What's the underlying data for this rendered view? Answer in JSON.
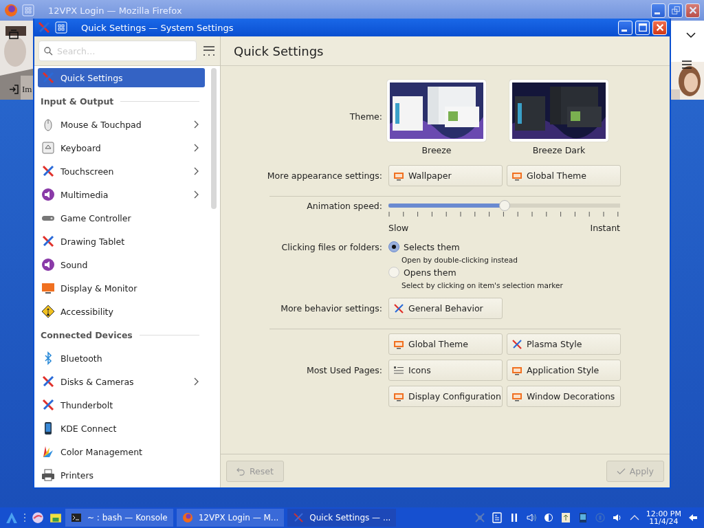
{
  "firefox_window": {
    "title": "12VPX Login — Mozilla Firefox",
    "page_text": "Im"
  },
  "settings_window": {
    "title": "Quick Settings — System Settings"
  },
  "sidebar": {
    "search": {
      "placeholder": "Search…"
    },
    "items": [
      {
        "kind": "item",
        "label": "Quick Settings",
        "selected": true,
        "has_arrow": false
      },
      {
        "kind": "section",
        "label": "Input & Output"
      },
      {
        "kind": "item",
        "label": "Mouse & Touchpad",
        "selected": false,
        "has_arrow": true
      },
      {
        "kind": "item",
        "label": "Keyboard",
        "selected": false,
        "has_arrow": true
      },
      {
        "kind": "item",
        "label": "Touchscreen",
        "selected": false,
        "has_arrow": true
      },
      {
        "kind": "item",
        "label": "Multimedia",
        "selected": false,
        "has_arrow": true
      },
      {
        "kind": "item",
        "label": "Game Controller",
        "selected": false,
        "has_arrow": false
      },
      {
        "kind": "item",
        "label": "Drawing Tablet",
        "selected": false,
        "has_arrow": false
      },
      {
        "kind": "item",
        "label": "Sound",
        "selected": false,
        "has_arrow": false
      },
      {
        "kind": "item",
        "label": "Display & Monitor",
        "selected": false,
        "has_arrow": false
      },
      {
        "kind": "item",
        "label": "Accessibility",
        "selected": false,
        "has_arrow": false
      },
      {
        "kind": "section",
        "label": "Connected Devices"
      },
      {
        "kind": "item",
        "label": "Bluetooth",
        "selected": false,
        "has_arrow": false
      },
      {
        "kind": "item",
        "label": "Disks & Cameras",
        "selected": false,
        "has_arrow": true
      },
      {
        "kind": "item",
        "label": "Thunderbolt",
        "selected": false,
        "has_arrow": false
      },
      {
        "kind": "item",
        "label": "KDE Connect",
        "selected": false,
        "has_arrow": false
      },
      {
        "kind": "item",
        "label": "Color Management",
        "selected": false,
        "has_arrow": false
      },
      {
        "kind": "item",
        "label": "Printers",
        "selected": false,
        "has_arrow": false
      }
    ]
  },
  "page": {
    "title": "Quick Settings",
    "theme": {
      "label": "Theme:",
      "options": [
        {
          "name": "Breeze"
        },
        {
          "name": "Breeze Dark"
        }
      ]
    },
    "appearance": {
      "label": "More appearance settings:",
      "buttons": [
        "Wallpaper",
        "Global Theme"
      ]
    },
    "animation": {
      "label": "Animation speed:",
      "level": 0.5,
      "min_label": "Slow",
      "max_label": "Instant"
    },
    "clicking": {
      "label": "Clicking files or folders:",
      "options": [
        {
          "label": "Selects them",
          "hint": "Open by double-clicking instead",
          "selected": true
        },
        {
          "label": "Opens them",
          "hint": "Select by clicking on item's selection marker",
          "selected": false
        }
      ]
    },
    "behavior": {
      "label": "More behavior settings:",
      "buttons": [
        "General Behavior"
      ]
    },
    "most_used": {
      "label": "Most Used Pages:",
      "buttons": [
        "Global Theme",
        "Plasma Style",
        "Icons",
        "Application Style",
        "Display Configuration",
        "Window Decorations"
      ]
    }
  },
  "footer": {
    "buttons": [
      {
        "label": "Reset",
        "disabled": true
      },
      {
        "label": "Apply",
        "disabled": true
      }
    ]
  },
  "taskbar": {
    "tasks": [
      {
        "label": "~ : bash — Konsole",
        "selected": false
      },
      {
        "label": "12VPX Login — M...",
        "selected": false
      },
      {
        "label": "Quick Settings — ...",
        "selected": true
      }
    ],
    "clock": {
      "time": "12:00 PM",
      "date": "11/4/24"
    }
  }
}
